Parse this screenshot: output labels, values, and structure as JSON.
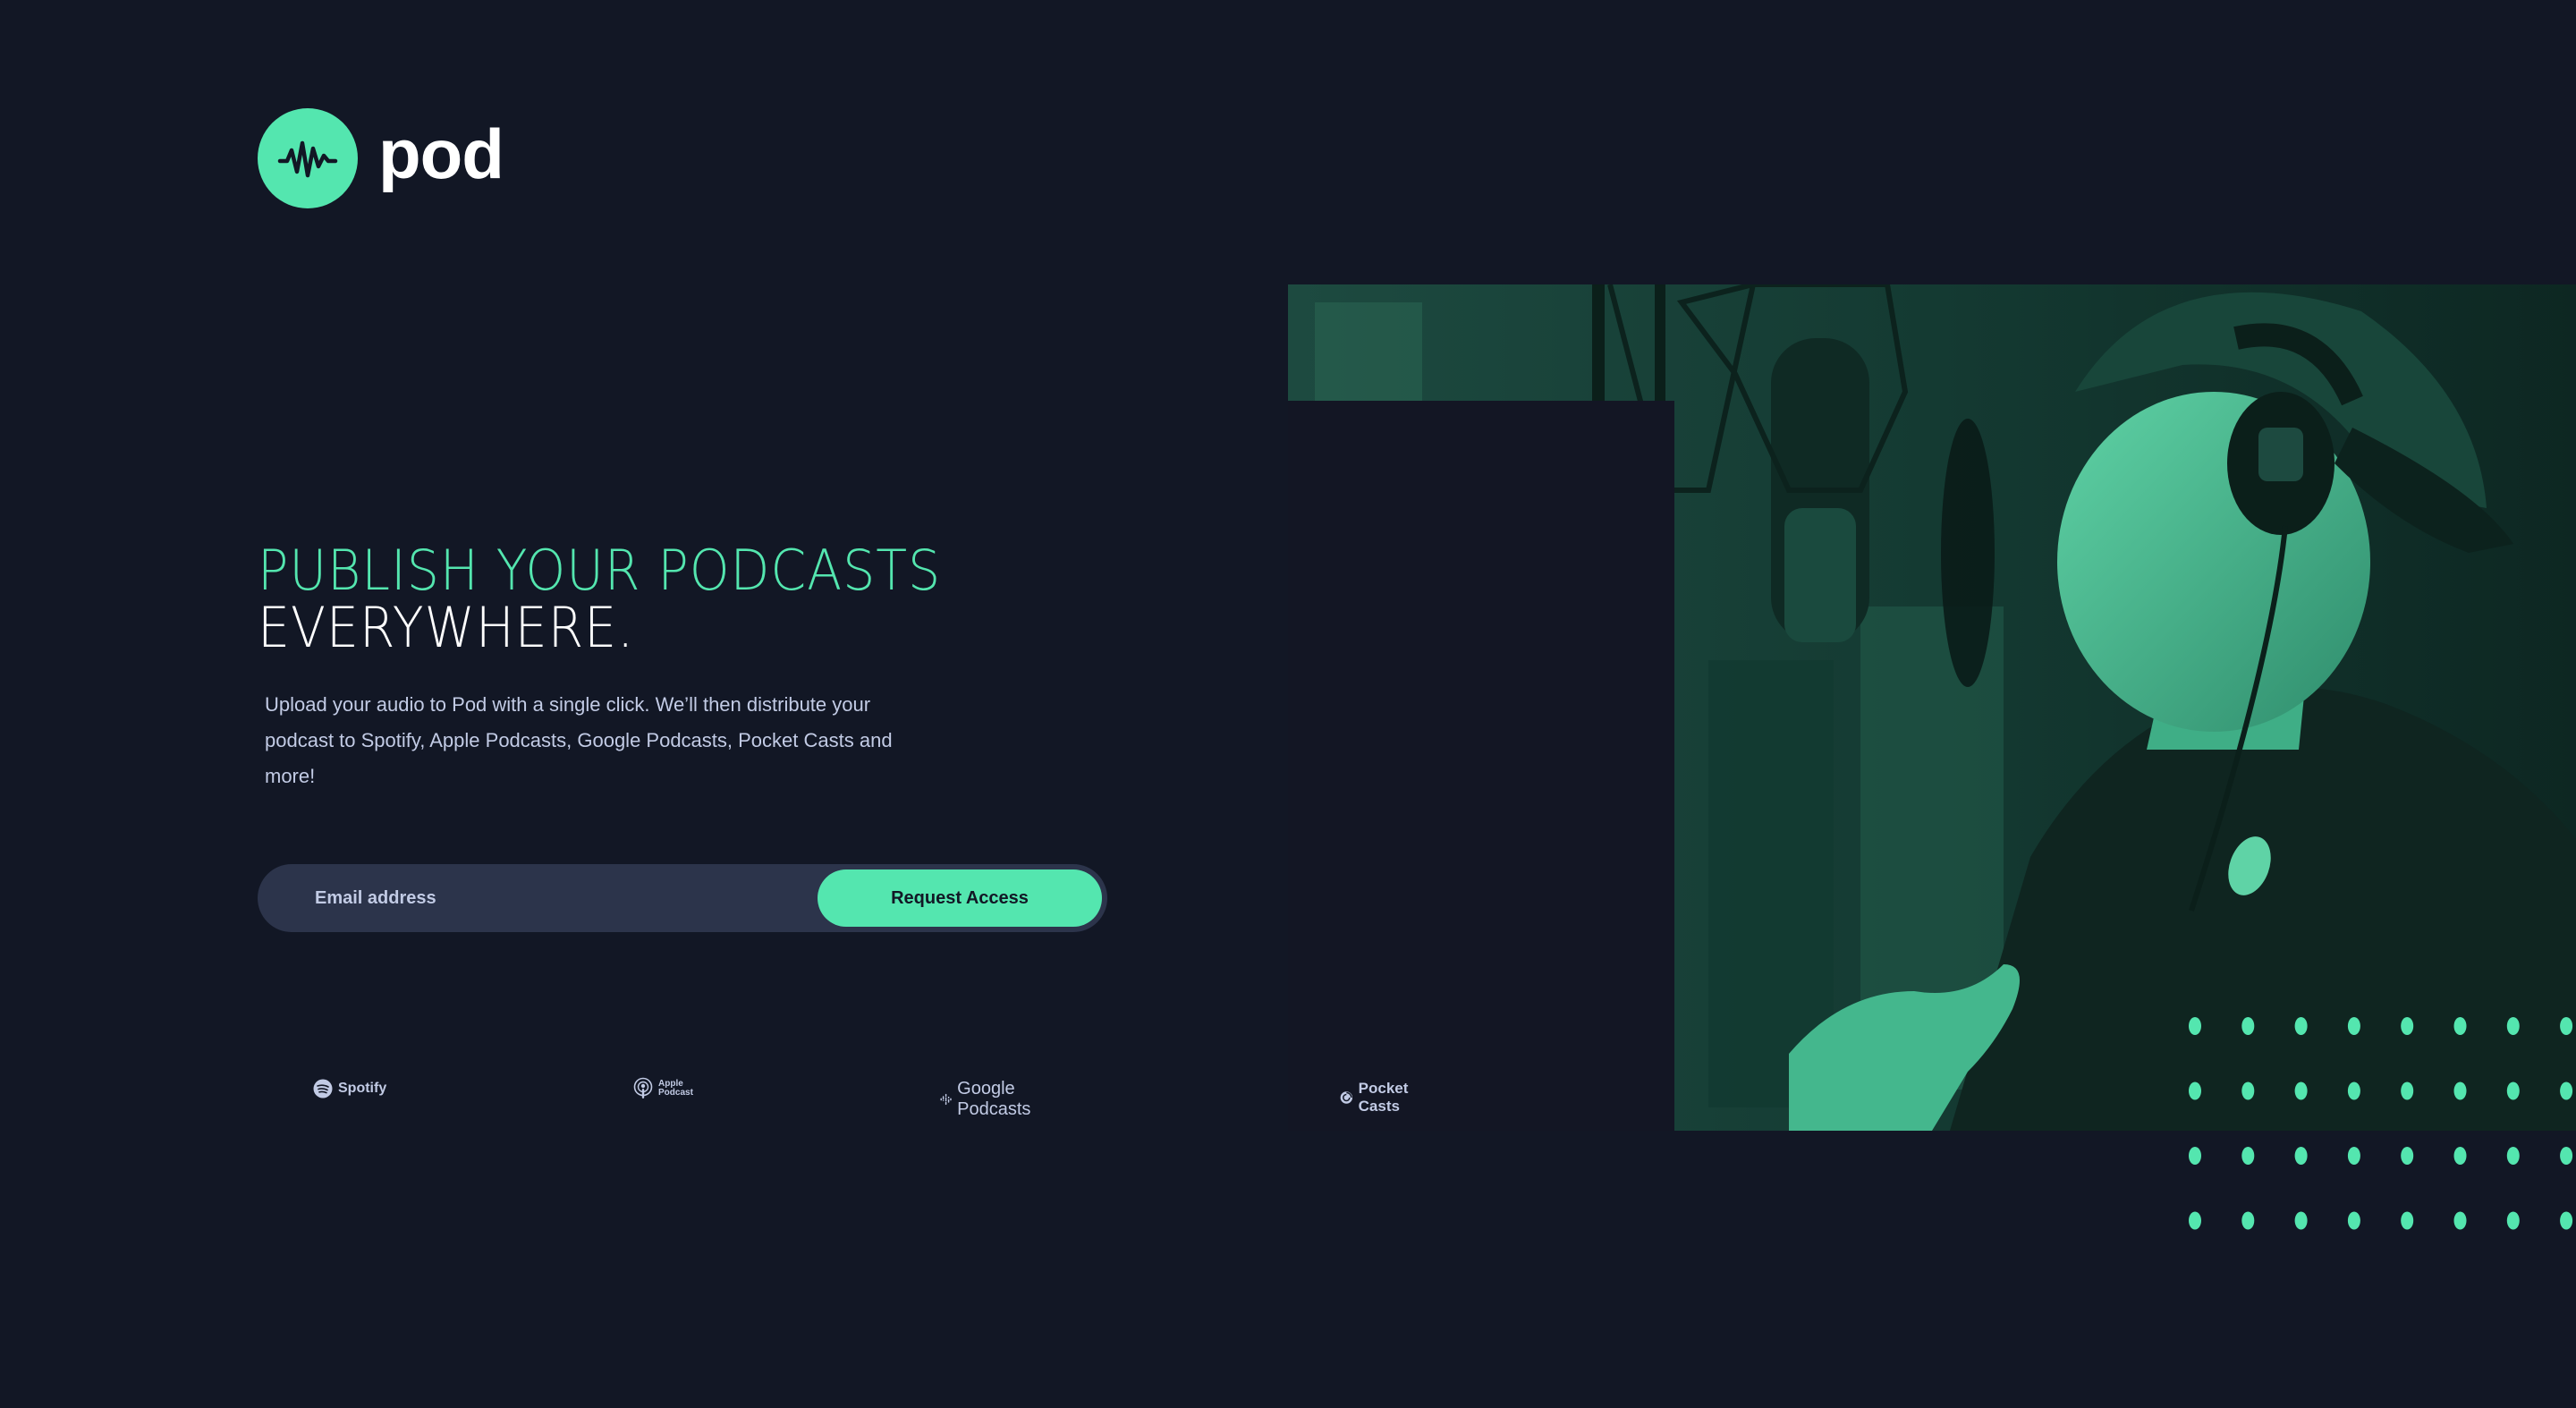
{
  "brand": {
    "name": "pod",
    "accent": "#54e6af",
    "background": "#121725",
    "field_background": "#2c344b",
    "text_muted": "#c2cbe5"
  },
  "hero": {
    "title_line1": "PUBLISH YOUR PODCASTS",
    "title_line2": "EVERYWHERE.",
    "description": "Upload your audio to Pod with a single click. We’ll then distribute your podcast to Spotify, Apple Podcasts, Google Podcasts, Pocket Casts and more!",
    "image_alt": "podcast-host-with-headphones-microphone-icon"
  },
  "signup": {
    "email_placeholder": "Email address",
    "submit_label": "Request Access"
  },
  "platforms": [
    {
      "name": "Spotify",
      "icon": "spotify-icon"
    },
    {
      "name_line1": "Apple",
      "name_line2": "Podcast",
      "icon": "apple-podcasts-icon"
    },
    {
      "name": "Google Podcasts",
      "icon": "google-podcasts-icon"
    },
    {
      "name": "Pocket Casts",
      "icon": "pocket-casts-icon"
    }
  ]
}
